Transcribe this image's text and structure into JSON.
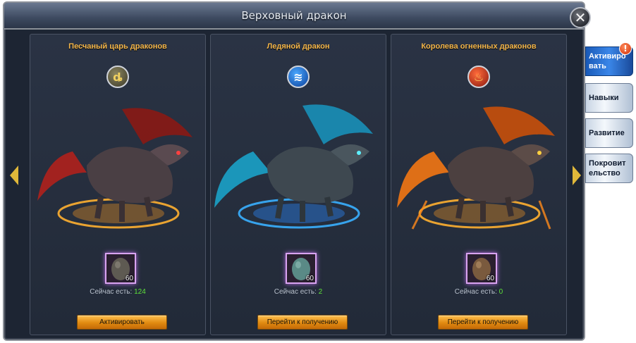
{
  "window": {
    "title": "Верховный дракон",
    "close_glyph": "✕"
  },
  "panels": [
    {
      "name": "Песчаный царь драконов",
      "element_icon": "sand-element-icon",
      "element_glyph": "ȡ",
      "egg_count": "60",
      "owned_label": "Сейчас есть:",
      "owned_value": "124",
      "button_label": "Активировать"
    },
    {
      "name": "Ледяной дракон",
      "element_icon": "ice-element-icon",
      "element_glyph": "≋",
      "egg_count": "60",
      "owned_label": "Сейчас есть:",
      "owned_value": "2",
      "button_label": "Перейти к получению"
    },
    {
      "name": "Королева огненных драконов",
      "element_icon": "fire-element-icon",
      "element_glyph": "♨",
      "egg_count": "60",
      "owned_label": "Сейчас есть:",
      "owned_value": "0",
      "button_label": "Перейти к получению"
    }
  ],
  "side_tabs": [
    {
      "label": "Активиро вать",
      "active": true
    },
    {
      "label": "Навыки",
      "active": false
    },
    {
      "label": "Развитие",
      "active": false
    },
    {
      "label": "Покровит ельство",
      "active": false
    }
  ],
  "alert_badge": "!",
  "colors": {
    "dragon_sand": "#c8281a",
    "dragon_ice": "#1fc8f0",
    "dragon_fire": "#ff7a10",
    "accent_gold": "#f4b64a",
    "owned_green": "#5de03a"
  }
}
